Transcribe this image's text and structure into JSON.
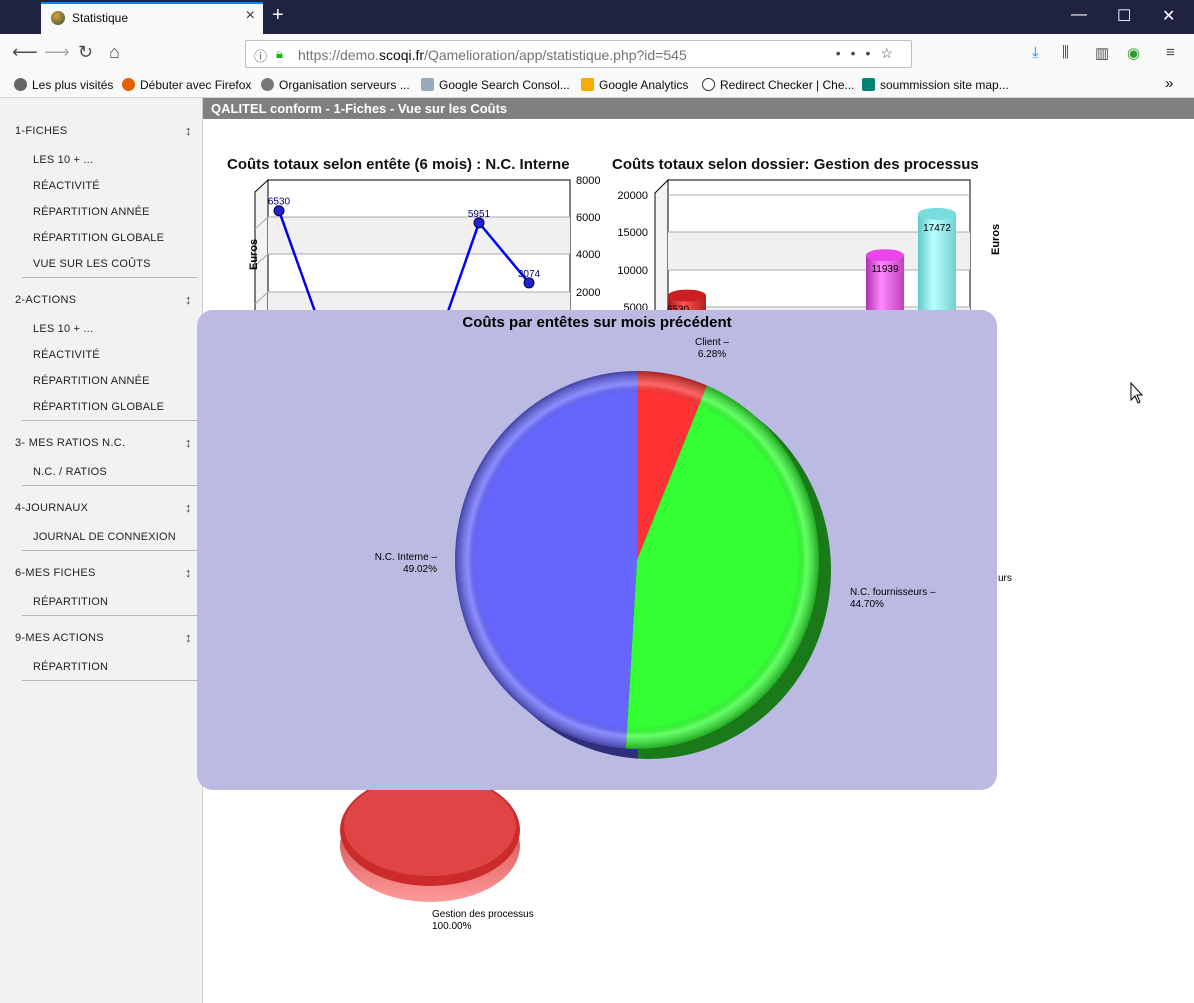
{
  "browser": {
    "tab_title": "Statistique",
    "url_prefix": "https://demo.",
    "url_domain": "scoqi.fr",
    "url_path": "/Qamelioration/app/statistique.php?id=545",
    "bookmarks": [
      "Les plus visités",
      "Débuter avec Firefox",
      "Organisation serveurs ...",
      "Google Search Consol...",
      "Google Analytics",
      "Redirect Checker | Che...",
      "soummission site map..."
    ]
  },
  "page": {
    "header": "QALITEL conform - 1-Fiches - Vue sur les Coûts"
  },
  "sidebar": {
    "sections": [
      {
        "label": "1-FICHES",
        "items": [
          "LES 10 + ...",
          "RÉACTIVITÉ",
          "RÉPARTITION ANNÉE",
          "RÉPARTITION GLOBALE",
          "VUE SUR LES COÛTS"
        ]
      },
      {
        "label": "2-ACTIONS",
        "items": [
          "LES 10 + ...",
          "RÉACTIVITÉ",
          "RÉPARTITION ANNÉE",
          "RÉPARTITION GLOBALE"
        ]
      },
      {
        "label": "3- MES RATIOS N.C.",
        "items": [
          "N.C. / RATIOS"
        ]
      },
      {
        "label": "4-JOURNAUX",
        "items": [
          "JOURNAL DE CONNEXION"
        ]
      },
      {
        "label": "6-MES FICHES",
        "items": [
          "RÉPARTITION"
        ]
      },
      {
        "label": "9-MES ACTIONS",
        "items": [
          "RÉPARTITION"
        ]
      }
    ]
  },
  "chart_data": [
    {
      "type": "line",
      "title": "Coûts totaux selon entête (6 mois) : N.C. Interne",
      "ylabel": "Euros",
      "y_ticks": [
        "8000",
        "6000",
        "4000",
        "2000"
      ],
      "points_visible": [
        {
          "label": "6530",
          "value": 6530
        },
        {
          "label": "5951",
          "value": 5951
        },
        {
          "label": "3074",
          "value": 3074
        }
      ],
      "color": "#0000ff"
    },
    {
      "type": "bar",
      "title": "Coûts totaux selon dossier:  Gestion des processus",
      "ylabel": "Euros",
      "y_ticks": [
        "20000",
        "15000",
        "10000",
        "5000"
      ],
      "bars_visible": [
        {
          "label": "6530",
          "value": 6530,
          "color": "#dd2b2b"
        },
        {
          "label": "11939",
          "value": 11939,
          "color": "#ee55ee"
        },
        {
          "label": "17472",
          "value": 17472,
          "color": "#88eeee"
        }
      ],
      "cut_label": "urs"
    },
    {
      "type": "pie",
      "title": "Coûts par entêtes sur mois précédent",
      "slices": [
        {
          "name": "Client",
          "percent": 6.28,
          "pct_label": "6.28%",
          "color": "#ff3333"
        },
        {
          "name": "N.C. fournisseurs",
          "percent": 44.7,
          "pct_label": "44.70%",
          "color": "#33ff33"
        },
        {
          "name": "N.C. Interne",
          "percent": 49.02,
          "pct_label": "49.02%",
          "color": "#6666ff"
        }
      ]
    },
    {
      "type": "pie",
      "slices": [
        {
          "name": "Gestion des processus",
          "percent": 100,
          "pct_label": "100.00%",
          "color": "#dd3333"
        }
      ]
    }
  ]
}
